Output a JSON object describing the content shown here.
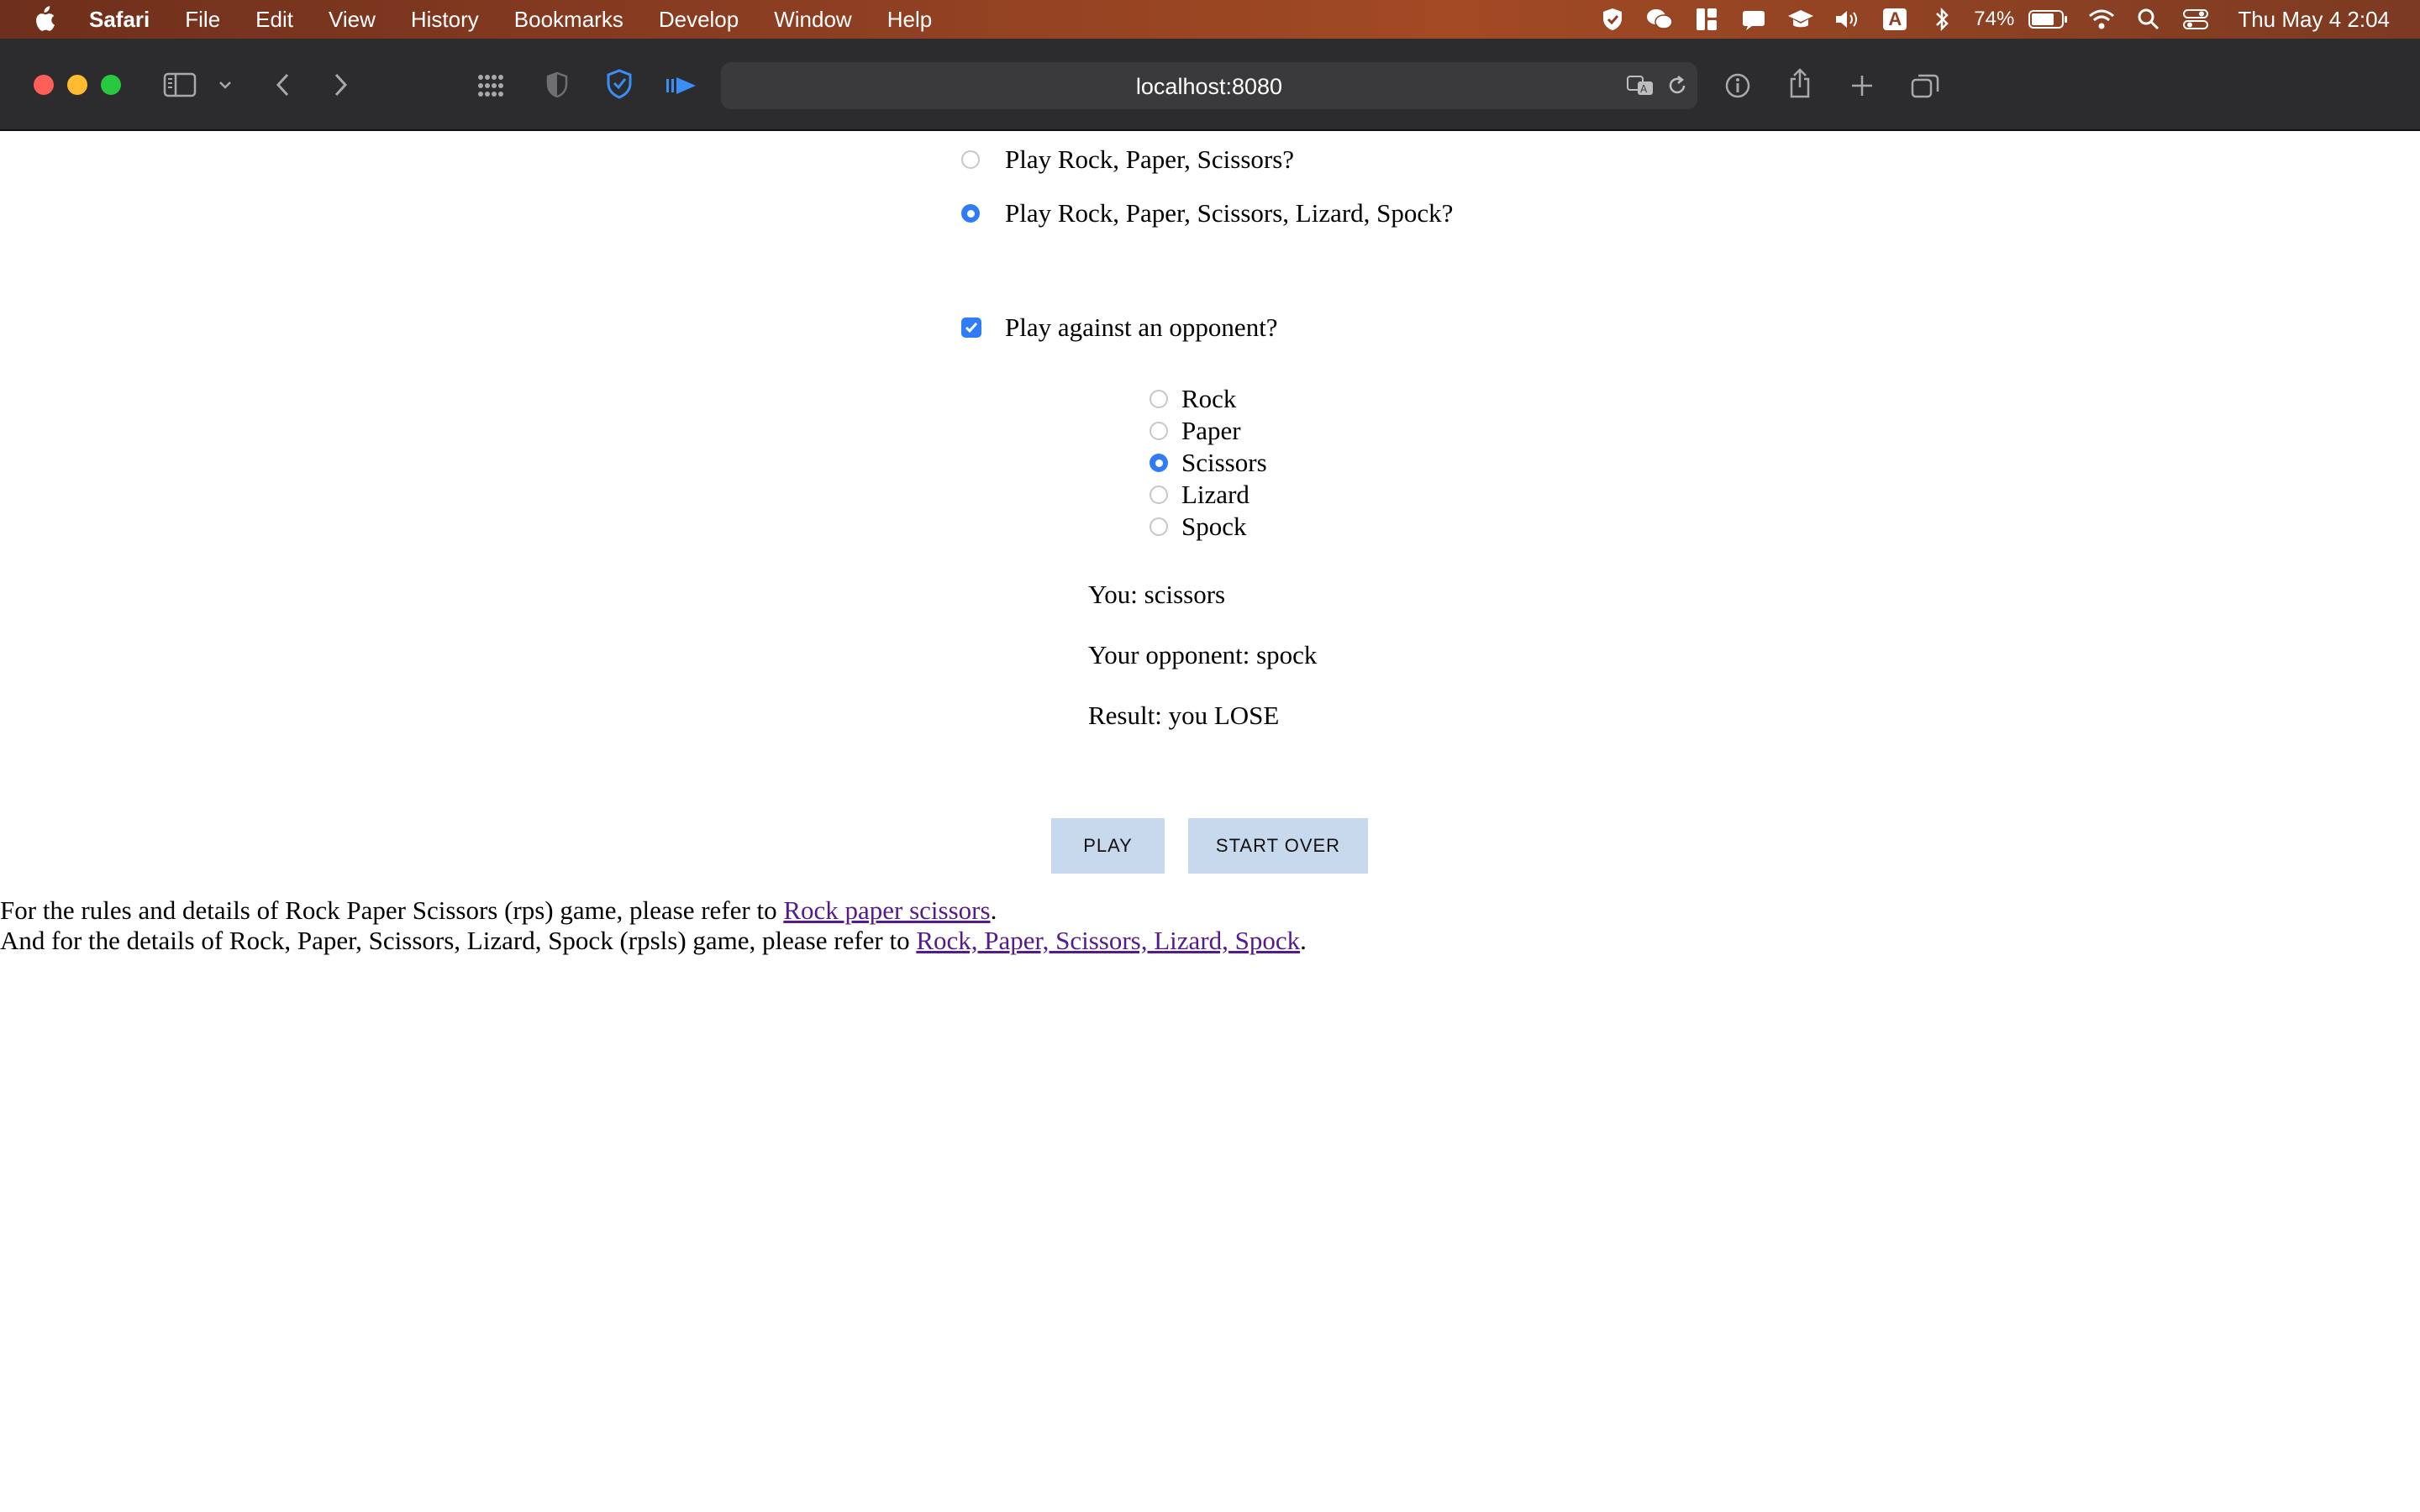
{
  "menubar": {
    "items": [
      "Safari",
      "File",
      "Edit",
      "View",
      "History",
      "Bookmarks",
      "Develop",
      "Window",
      "Help"
    ],
    "battery_percent": "74%",
    "clock": "Thu May 4  2:04",
    "status_icons": [
      "shield-icon",
      "wechat-icon",
      "widget-icon",
      "notification-icon",
      "graduation-cap-icon",
      "volume-icon",
      "input-source-icon",
      "bluetooth-icon",
      "battery-icon",
      "wifi-icon",
      "spotlight-icon",
      "control-center-icon"
    ],
    "input_source_letter": "A"
  },
  "browser": {
    "url": "localhost:8080",
    "toolbar_icons": [
      "sidebar-icon",
      "chevron-down-icon",
      "back-icon",
      "forward-icon",
      "grid-icon",
      "privacy-shield-icon",
      "blue-shield-icon",
      "playback-icon",
      "translate-icon",
      "reload-icon",
      "info-icon",
      "share-icon",
      "new-tab-icon",
      "tabs-overview-icon"
    ]
  },
  "game": {
    "mode_options": [
      {
        "label": "Play Rock, Paper, Scissors?",
        "selected": false
      },
      {
        "label": "Play Rock, Paper, Scissors, Lizard, Spock?",
        "selected": true
      }
    ],
    "opponent_checkbox": {
      "label": "Play against an opponent?",
      "checked": true
    },
    "moves": [
      {
        "label": "Rock",
        "selected": false
      },
      {
        "label": "Paper",
        "selected": false
      },
      {
        "label": "Scissors",
        "selected": true
      },
      {
        "label": "Lizard",
        "selected": false
      },
      {
        "label": "Spock",
        "selected": false
      }
    ],
    "you": "You: scissors",
    "opponent": "Your opponent: spock",
    "result": "Result: you LOSE",
    "play_button": "PLAY",
    "start_over_button": "START OVER"
  },
  "footer": {
    "line1_prefix": "For the rules and details of Rock Paper Scissors (rps) game, please refer to ",
    "line1_link": "Rock paper scissors",
    "line1_suffix": ".",
    "line2_prefix": "And for the details of Rock, Paper, Scissors, Lizard, Spock (rpsls) game, please refer to ",
    "line2_link": "Rock, Paper, Scissors, Lizard, Spock",
    "line2_suffix": "."
  },
  "colors": {
    "accent": "#2f7cf6",
    "button_bg": "#c8d9ee",
    "link_visited": "#551a8b",
    "toolbar_bg": "#2c2c2e"
  }
}
